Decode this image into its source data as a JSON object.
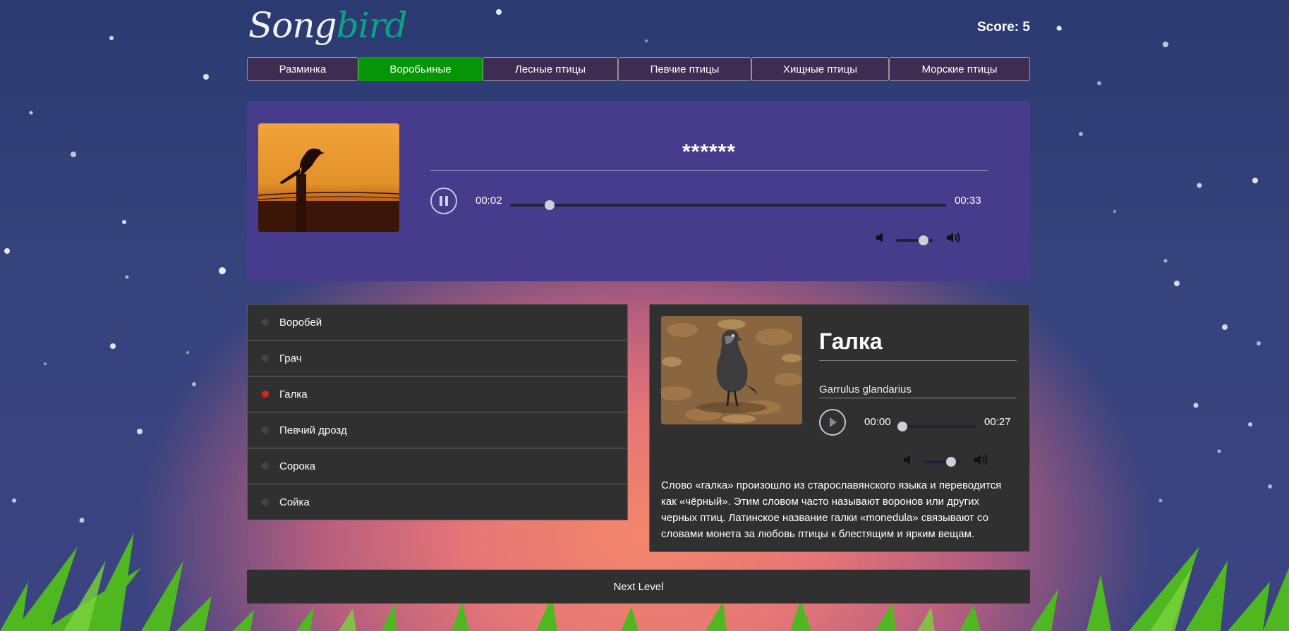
{
  "header": {
    "logo_part1": "Song",
    "logo_part2": "bird",
    "score_label": "Score:",
    "score_value": "5"
  },
  "tabs": [
    {
      "label": "Разминка",
      "active": false
    },
    {
      "label": "Воробьиные",
      "active": true
    },
    {
      "label": "Лесные птицы",
      "active": false
    },
    {
      "label": "Певчие птицы",
      "active": false
    },
    {
      "label": "Хищные птицы",
      "active": false
    },
    {
      "label": "Морские птицы",
      "active": false
    }
  ],
  "player": {
    "hidden_name": "******",
    "state": "playing",
    "current_time": "00:02",
    "duration": "00:33",
    "progress": 0.09,
    "volume": 0.75
  },
  "options": [
    {
      "label": "Воробей",
      "status": "none"
    },
    {
      "label": "Грач",
      "status": "none"
    },
    {
      "label": "Галка",
      "status": "wrong"
    },
    {
      "label": "Певчий дрозд",
      "status": "none"
    },
    {
      "label": "Сорока",
      "status": "none"
    },
    {
      "label": "Сойка",
      "status": "none"
    }
  ],
  "details": {
    "name": "Галка",
    "latin": "Garrulus glandarius",
    "state": "paused",
    "current_time": "00:00",
    "duration": "00:27",
    "progress": 0.0,
    "volume": 0.75,
    "description": "Слово «галка» произошло из старославянского языка и переводится как «чёрный». Этим словом часто называют воронов или других черных птиц. Латинское название галки «monedula» связывают со словами монета за любовь птицы к блестящим и ярким вещам."
  },
  "next_button": "Next Level",
  "colors": {
    "active_tab": "#079508",
    "logo_accent": "#0aa383",
    "player_bg": "#473c8b",
    "panel_bg": "#303030",
    "wrong_dot": "#d8261a"
  }
}
